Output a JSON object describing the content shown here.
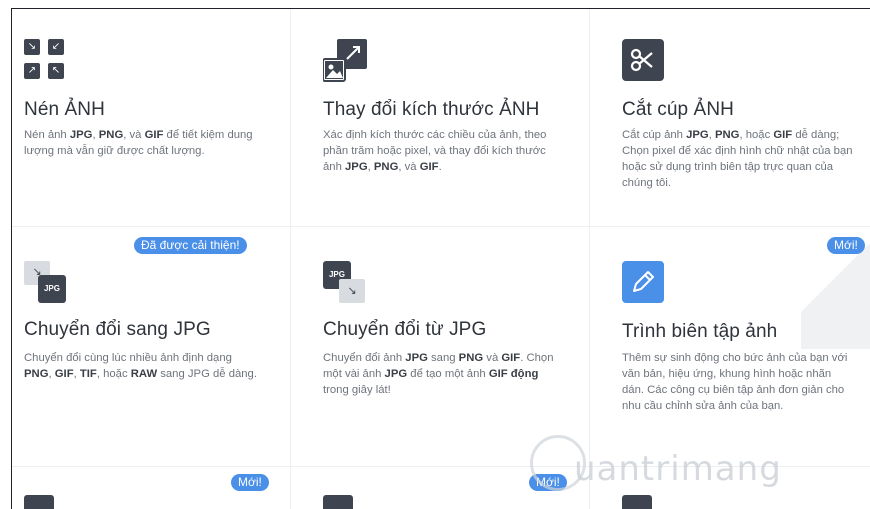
{
  "cards": [
    {
      "title": "Nén ẢNH",
      "desc_parts": [
        {
          "t": "Nén ảnh "
        },
        {
          "b": "JPG"
        },
        {
          "t": ", "
        },
        {
          "b": "PNG"
        },
        {
          "t": ", và "
        },
        {
          "b": "GIF"
        },
        {
          "t": " để tiết kiệm dung lượng mà vẫn giữ được chất lượng."
        }
      ],
      "icon": "compress-icon"
    },
    {
      "title": "Thay đổi kích thước ẢNH",
      "desc_parts": [
        {
          "t": "Xác định kích thước các chiều của ảnh, theo phần trăm hoặc pixel, và thay đổi kích thước ảnh "
        },
        {
          "b": "JPG"
        },
        {
          "t": ", "
        },
        {
          "b": "PNG"
        },
        {
          "t": ", và "
        },
        {
          "b": "GIF"
        },
        {
          "t": "."
        }
      ],
      "icon": "resize-image-icon"
    },
    {
      "title": "Cắt cúp ẢNH",
      "desc_parts": [
        {
          "t": "Cắt cúp ảnh "
        },
        {
          "b": "JPG"
        },
        {
          "t": ", "
        },
        {
          "b": "PNG"
        },
        {
          "t": ", hoặc "
        },
        {
          "b": "GIF"
        },
        {
          "t": " dễ dàng; Chọn pixel để xác định hình chữ nhật của bạn hoặc sử dụng trình biên tập trực quan của chúng tôi."
        }
      ],
      "icon": "scissors-icon"
    },
    {
      "title": "Chuyển đổi sang JPG",
      "badge": "Đã được cải thiện!",
      "desc_parts": [
        {
          "t": "Chuyển đổi cùng lúc nhiều ảnh định dạng "
        },
        {
          "b": "PNG"
        },
        {
          "t": ", "
        },
        {
          "b": "GIF"
        },
        {
          "t": ", "
        },
        {
          "b": "TIF"
        },
        {
          "t": ", hoặc "
        },
        {
          "b": "RAW"
        },
        {
          "t": " sang JPG dễ dàng."
        }
      ],
      "icon": "convert-to-jpg-icon",
      "icon_label": "JPG"
    },
    {
      "title": "Chuyển đổi từ JPG",
      "desc_parts": [
        {
          "t": "Chuyển đổi ảnh "
        },
        {
          "b": "JPG"
        },
        {
          "t": " sang "
        },
        {
          "b": "PNG"
        },
        {
          "t": " và "
        },
        {
          "b": "GIF"
        },
        {
          "t": ". Chọn một vài ảnh "
        },
        {
          "b": "JPG"
        },
        {
          "t": " để tạo một ảnh "
        },
        {
          "b": "GIF động"
        },
        {
          "t": " trong giây lát!"
        }
      ],
      "icon": "convert-from-jpg-icon",
      "icon_label": "JPG"
    },
    {
      "title": "Trình biên tập ảnh",
      "badge": "Mới!",
      "desc_parts": [
        {
          "t": "Thêm sự sinh động cho bức ảnh của bạn với văn bản, hiệu ứng, khung hình hoặc nhãn dán. Các công cụ biên tập ảnh đơn giản cho nhu cầu chỉnh sửa ảnh của bạn."
        }
      ],
      "icon": "pencil-icon"
    }
  ],
  "row3_badges": [
    "Mới!",
    "Mới!"
  ],
  "watermark": "uantrimang",
  "colors": {
    "accent": "#4a8fe8",
    "icon_dark": "#3f4550",
    "text": "#2f343b",
    "muted": "#6e747c"
  }
}
